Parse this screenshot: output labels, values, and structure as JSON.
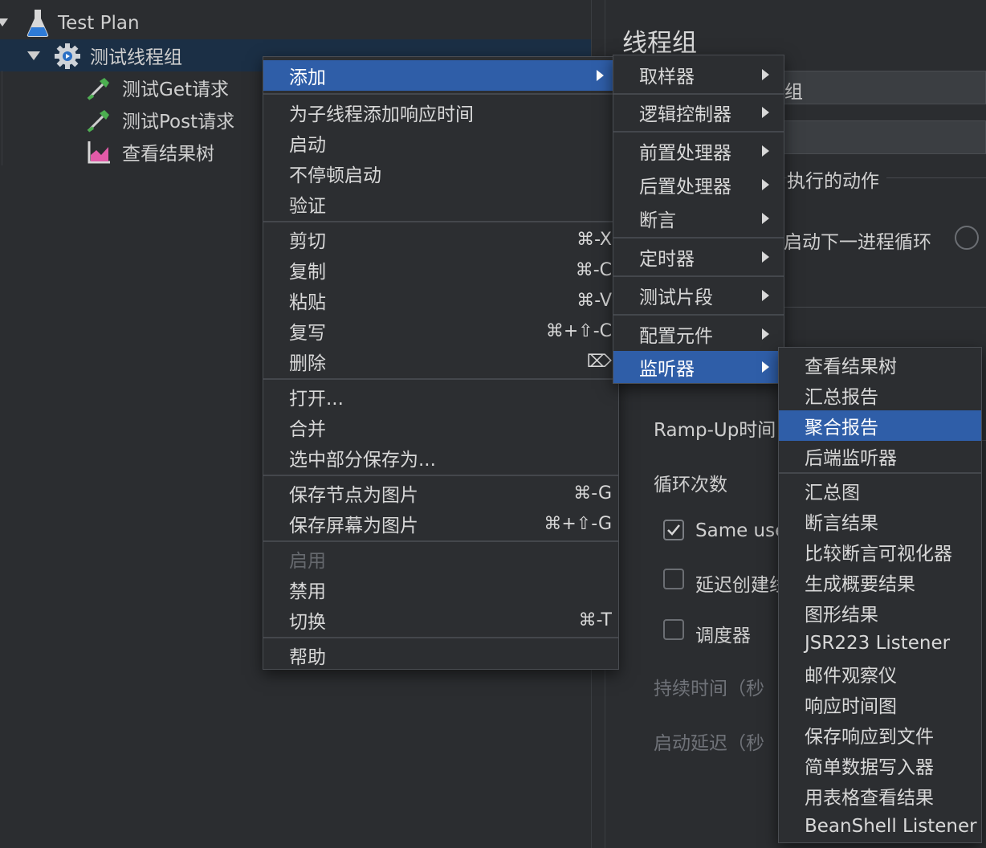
{
  "tree": {
    "test_plan": "Test Plan",
    "thread_group": "测试线程组",
    "get_request": "测试Get请求",
    "post_request": "测试Post请求",
    "result_tree": "查看结果树"
  },
  "right_panel": {
    "title": "线程组",
    "name_suffix": "组",
    "action_label": "执行的动作",
    "next_loop_label": "启动下一进程循环",
    "rampup_label": "Ramp-Up时间",
    "loop_label": "循环次数",
    "same_user_label": "Same use",
    "same_user_checked": true,
    "delay_create_label": "延迟创建线",
    "scheduler_label": "调度器",
    "duration_label": "持续时间（秒",
    "startup_delay_label": "启动延迟（秒"
  },
  "context_menu": {
    "add": "添加",
    "add_response_time": "为子线程添加响应时间",
    "start": "启动",
    "start_no_pause": "不停顿启动",
    "validate": "验证",
    "cut": "剪切",
    "cut_sc": "⌘-X",
    "copy": "复制",
    "copy_sc": "⌘-C",
    "paste": "粘贴",
    "paste_sc": "⌘-V",
    "duplicate": "复写",
    "duplicate_sc": "⌘+⇧-C",
    "delete": "删除",
    "delete_sc": "⌦",
    "open": "打开...",
    "merge": "合并",
    "save_selection_as": "选中部分保存为...",
    "save_node_image": "保存节点为图片",
    "save_node_image_sc": "⌘-G",
    "save_screen_image": "保存屏幕为图片",
    "save_screen_image_sc": "⌘+⇧-G",
    "enable": "启用",
    "disable": "禁用",
    "toggle": "切换",
    "toggle_sc": "⌘-T",
    "help": "帮助"
  },
  "add_submenu": {
    "sampler": "取样器",
    "logic_controller": "逻辑控制器",
    "pre_processor": "前置处理器",
    "post_processor": "后置处理器",
    "assertion": "断言",
    "timer": "定时器",
    "test_fragment": "测试片段",
    "config_element": "配置元件",
    "listener": "监听器"
  },
  "listener_submenu": {
    "items": [
      "查看结果树",
      "汇总报告",
      "聚合报告",
      "后端监听器",
      "汇总图",
      "断言结果",
      "比较断言可视化器",
      "生成概要结果",
      "图形结果",
      "JSR223 Listener",
      "邮件观察仪",
      "响应时间图",
      "保存响应到文件",
      "简单数据写入器",
      "用表格查看结果",
      "BeanShell Listener"
    ],
    "highlighted": "聚合报告"
  },
  "colors": {
    "background": "#2b2d30",
    "highlight": "#2f5ea8",
    "selected_row": "#1b2f45",
    "text": "#d8d8d8"
  }
}
